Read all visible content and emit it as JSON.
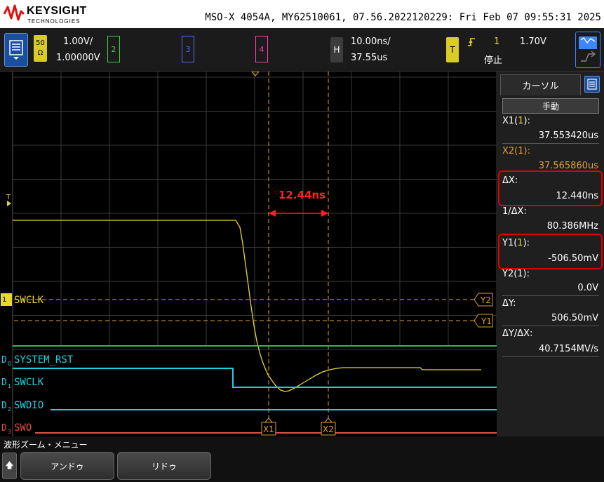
{
  "header": {
    "brand": "KEYSIGHT",
    "brand_sub": "TECHNOLOGIES",
    "title": "MSO-X 4054A, MY62510061, 07.56.2022120229: Fri Feb 07 09:55:31 2025"
  },
  "controls": {
    "ch1": {
      "badge_top": "50",
      "badge_bottom": "Ω",
      "scale": "1.00V/",
      "offset": "1.00000V"
    },
    "ch2": "2",
    "ch3": "3",
    "ch4": "4",
    "horizontal": {
      "badge": "H",
      "scale": "10.00ns/",
      "position": "37.55us"
    },
    "trigger": {
      "badge": "T",
      "slope_icon": "rising-edge-icon",
      "source": "1",
      "level": "1.70V",
      "status": "停止"
    }
  },
  "plot": {
    "measure_label": "12.44ns",
    "trigger_marker": "T",
    "analog_label": "SWCLK",
    "analog_channel_marker": "1",
    "cursor_x1": "X1",
    "cursor_x2": "X2",
    "cursor_y1": "Y1",
    "cursor_y2": "Y2",
    "digital": [
      {
        "prefix": "D",
        "sub": "0",
        "name": "SYSTEM_RST"
      },
      {
        "prefix": "D",
        "sub": "1",
        "name": "SWCLK"
      },
      {
        "prefix": "D",
        "sub": "2",
        "name": "SWDIO"
      },
      {
        "prefix": "D",
        "sub": "3",
        "name": "SWO"
      }
    ],
    "colors": {
      "analog": "#e8d82a",
      "cursor": "#e0a030",
      "digital": "#20d0e0",
      "d0": "#20c050",
      "d3": "#e05040",
      "measure": "#ff2020"
    }
  },
  "cursors_panel": {
    "tab": "カーソル",
    "mode": "手動",
    "x1_label_pre": "X1(",
    "x1_label_ch": "1",
    "x1_label_post": "):",
    "x1_value": "37.553420us",
    "x2_label": "X2(1):",
    "x2_value": "37.565860us",
    "dx_label": "ΔX:",
    "dx_value": "12.440ns",
    "inv_dx_label": "1/ΔX:",
    "inv_dx_value": "80.386MHz",
    "y1_label_pre": "Y1(",
    "y1_label_ch": "1",
    "y1_label_post": "):",
    "y1_value": "-506.50mV",
    "y2_label": "Y2(1):",
    "y2_value": "0.0V",
    "dy_label": "ΔY:",
    "dy_value": "506.50mV",
    "dydx_label": "ΔY/ΔX:",
    "dydx_value": "40.7154MV/s"
  },
  "softkeys": {
    "title": "波形ズーム・メニュー",
    "undo": "アンドゥ",
    "redo": "リドゥ"
  }
}
